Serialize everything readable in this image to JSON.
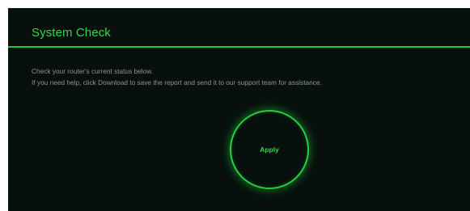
{
  "page": {
    "title": "System Check"
  },
  "description": {
    "line1": "Check your router's current status below.",
    "line2": "If you need help, click Download to save the report and send it to our support team for assistance."
  },
  "actions": {
    "apply_label": "Apply"
  },
  "colors": {
    "background": "#07100d",
    "accent": "#2fd84a",
    "text_muted": "#8c958f"
  }
}
